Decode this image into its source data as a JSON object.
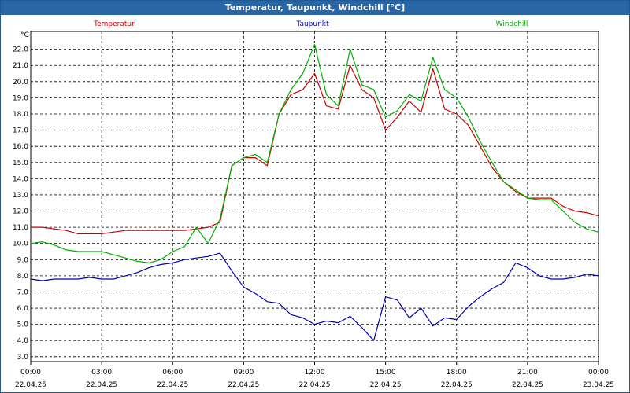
{
  "window": {
    "title": "Temperatur, Taupunkt, Windchill [°C]"
  },
  "colors": {
    "titlebar": "#2a66a6",
    "temperatur": "#cc0000",
    "taupunkt": "#0000b0",
    "windchill": "#00b000",
    "grid": "#000000"
  },
  "chart_data": {
    "type": "line",
    "title": "Temperatur, Taupunkt, Windchill [°C]",
    "ylabel": "°C",
    "xlabel": "",
    "xlim": [
      0,
      24
    ],
    "ylim": [
      2.7,
      23.1
    ],
    "grid": true,
    "legend": "top",
    "y_ticks": [
      "3.0",
      "4.0",
      "5.0",
      "6.0",
      "7.0",
      "8.0",
      "9.0",
      "10.0",
      "11.0",
      "12.0",
      "13.0",
      "14.0",
      "15.0",
      "16.0",
      "17.0",
      "18.0",
      "19.0",
      "20.0",
      "21.0",
      "22.0"
    ],
    "x_ticks": [
      {
        "time": "00:00",
        "date": "22.04.25"
      },
      {
        "time": "03:00",
        "date": "22.04.25"
      },
      {
        "time": "06:00",
        "date": "22.04.25"
      },
      {
        "time": "09:00",
        "date": "22.04.25"
      },
      {
        "time": "12:00",
        "date": "22.04.25"
      },
      {
        "time": "15:00",
        "date": "22.04.25"
      },
      {
        "time": "18:00",
        "date": "22.04.25"
      },
      {
        "time": "21:00",
        "date": "22.04.25"
      },
      {
        "time": "00:00",
        "date": "23.04.25"
      }
    ],
    "series": [
      {
        "name": "Temperatur",
        "color": "#cc0000",
        "x": [
          0,
          0.5,
          1,
          1.5,
          2,
          2.5,
          3,
          3.5,
          4,
          4.5,
          5,
          5.5,
          6,
          6.5,
          7,
          7.5,
          8,
          8.5,
          9,
          9.5,
          10,
          10.5,
          11,
          11.5,
          12,
          12.5,
          13,
          13.5,
          14,
          14.5,
          15,
          15.5,
          16,
          16.5,
          17,
          17.5,
          18,
          18.5,
          19,
          19.5,
          20,
          20.5,
          21,
          21.5,
          22,
          22.5,
          23,
          23.5,
          24
        ],
        "values": [
          11.0,
          11.0,
          10.9,
          10.8,
          10.6,
          10.6,
          10.6,
          10.7,
          10.8,
          10.8,
          10.8,
          10.8,
          10.8,
          10.8,
          10.9,
          11.0,
          11.3,
          14.8,
          15.3,
          15.3,
          14.8,
          18.0,
          19.2,
          19.5,
          20.5,
          18.5,
          18.3,
          21.0,
          19.5,
          19.0,
          17.0,
          17.8,
          18.8,
          18.1,
          20.8,
          18.3,
          18.0,
          17.3,
          16.0,
          14.7,
          13.8,
          13.2,
          12.8,
          12.8,
          12.8,
          12.3,
          12.0,
          11.9,
          11.7
        ]
      },
      {
        "name": "Taupunkt",
        "color": "#0000b0",
        "x": [
          0,
          0.5,
          1,
          1.5,
          2,
          2.5,
          3,
          3.5,
          4,
          4.5,
          5,
          5.5,
          6,
          6.5,
          7,
          7.5,
          8,
          8.5,
          9,
          9.5,
          10,
          10.5,
          11,
          11.5,
          12,
          12.5,
          13,
          13.5,
          14,
          14.5,
          15,
          15.5,
          16,
          16.5,
          17,
          17.5,
          18,
          18.5,
          19,
          19.5,
          20,
          20.5,
          21,
          21.5,
          22,
          22.5,
          23,
          23.5,
          24
        ],
        "values": [
          7.8,
          7.7,
          7.8,
          7.8,
          7.8,
          7.9,
          7.8,
          7.8,
          8.0,
          8.2,
          8.5,
          8.7,
          8.8,
          9.0,
          9.1,
          9.2,
          9.4,
          8.3,
          7.3,
          6.9,
          6.4,
          6.3,
          5.6,
          5.4,
          5.0,
          5.2,
          5.1,
          5.5,
          4.8,
          4.0,
          6.7,
          6.5,
          5.4,
          6.0,
          4.9,
          5.4,
          5.3,
          6.1,
          6.7,
          7.2,
          7.6,
          8.8,
          8.5,
          8.0,
          7.8,
          7.8,
          7.9,
          8.1,
          8.0
        ]
      },
      {
        "name": "Windchill",
        "color": "#00b000",
        "x": [
          0,
          0.5,
          1,
          1.5,
          2,
          2.5,
          3,
          3.5,
          4,
          4.5,
          5,
          5.5,
          6,
          6.5,
          7,
          7.5,
          8,
          8.5,
          9,
          9.5,
          10,
          10.5,
          11,
          11.5,
          12,
          12.5,
          13,
          13.5,
          14,
          14.5,
          15,
          15.5,
          16,
          16.5,
          17,
          17.5,
          18,
          18.5,
          19,
          19.5,
          20,
          20.5,
          21,
          21.5,
          22,
          22.5,
          23,
          23.5,
          24
        ],
        "values": [
          10.0,
          10.1,
          9.9,
          9.6,
          9.5,
          9.5,
          9.5,
          9.3,
          9.1,
          8.9,
          8.8,
          9.0,
          9.5,
          9.8,
          11.0,
          10.0,
          11.5,
          14.8,
          15.3,
          15.5,
          15.0,
          18.0,
          19.5,
          20.5,
          22.3,
          19.2,
          18.5,
          22.0,
          19.8,
          19.5,
          17.8,
          18.2,
          19.2,
          18.8,
          21.5,
          19.5,
          19.0,
          17.8,
          16.3,
          15.0,
          13.8,
          13.3,
          12.8,
          12.7,
          12.7,
          12.0,
          11.3,
          10.9,
          10.7
        ]
      }
    ]
  }
}
